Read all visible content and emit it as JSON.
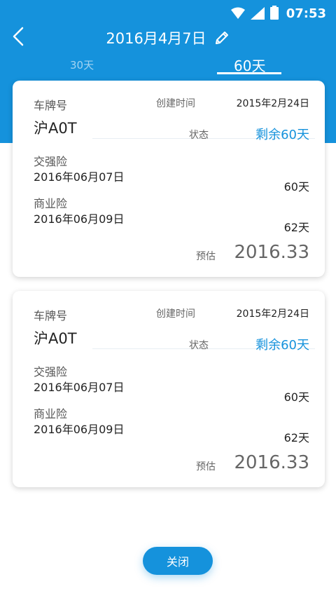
{
  "status_bar": {
    "time": "07:53"
  },
  "header": {
    "title": "2016月4月7日"
  },
  "tabs": [
    {
      "label": "30天",
      "selected": false
    },
    {
      "label": "60天",
      "selected": true
    }
  ],
  "cards": [
    {
      "plate_label": "车牌号",
      "plate": "沪A0T",
      "created_label": "创建时间",
      "created_value": "2015年2月24日",
      "status_label": "状态",
      "status_value": "剩余60天",
      "jqx_label": "交强险",
      "jqx_date": "2016年06月07日",
      "jqx_days": "60天",
      "syx_label": "商业险",
      "syx_date": "2016年06月09日",
      "syx_days": "62天",
      "estimate_label": "预估",
      "estimate_value": "2016.33"
    },
    {
      "plate_label": "车牌号",
      "plate": "沪A0T",
      "created_label": "创建时间",
      "created_value": "2015年2月24日",
      "status_label": "状态",
      "status_value": "剩余60天",
      "jqx_label": "交强险",
      "jqx_date": "2016年06月07日",
      "jqx_days": "60天",
      "syx_label": "商业险",
      "syx_date": "2016年06月09日",
      "syx_days": "62天",
      "estimate_label": "预估",
      "estimate_value": "2016.33"
    }
  ],
  "close_button": {
    "label": "关闭"
  },
  "colors": {
    "primary": "#1592dc",
    "card_bg": "#ffffff"
  },
  "icons": {
    "back": "back-chevron-icon",
    "edit": "pencil-icon",
    "wifi": "wifi-icon",
    "signal": "signal-icon",
    "battery": "battery-icon"
  }
}
